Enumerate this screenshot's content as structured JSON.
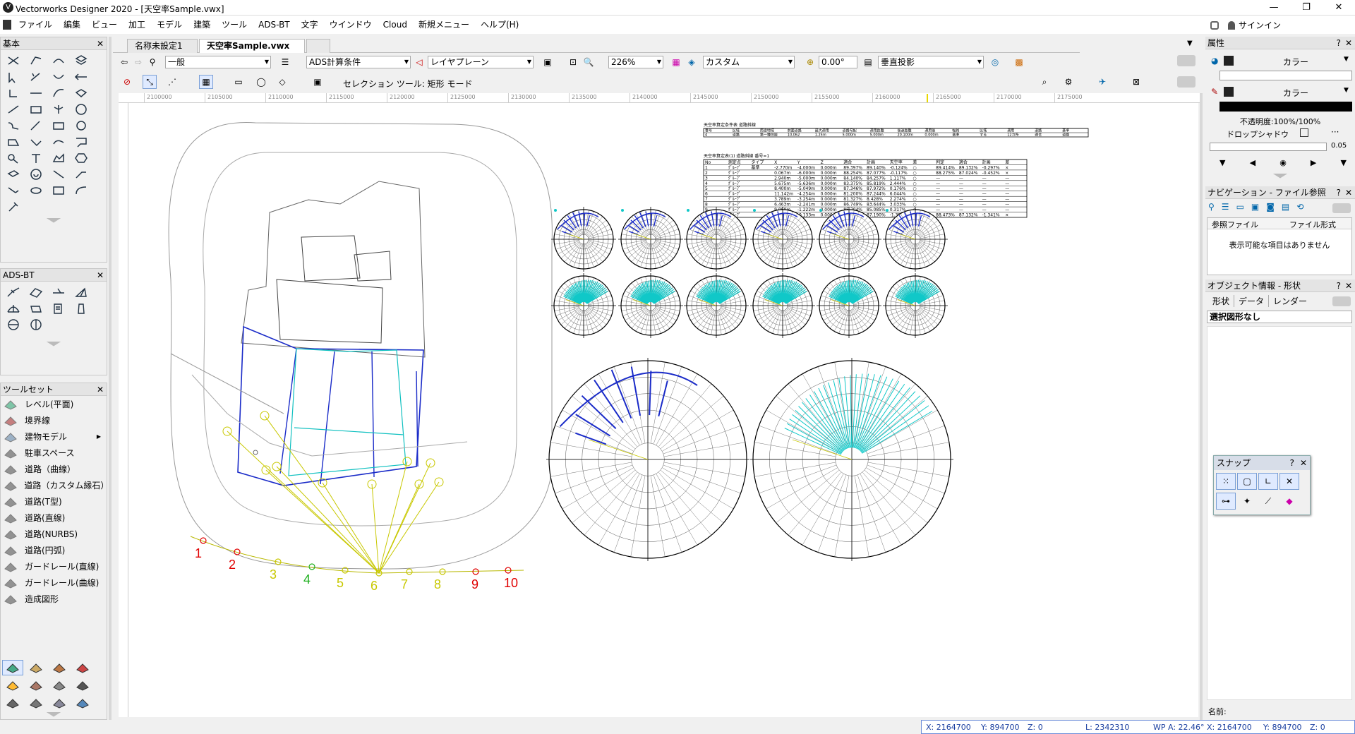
{
  "window": {
    "title": "Vectorworks Designer 2020 - [天空率Sample.vwx]",
    "min": "—",
    "max": "❐",
    "close": "✕"
  },
  "menu": [
    "ファイル",
    "編集",
    "ビュー",
    "加工",
    "モデル",
    "建築",
    "ツール",
    "ADS-BT",
    "文字",
    "ウインドウ",
    "Cloud",
    "新規メニュー",
    "ヘルプ(H)"
  ],
  "signin": "サインイン",
  "tabs": [
    "名称未設定1",
    "天空率Sample.vwx"
  ],
  "viewbar": {
    "class": "一般",
    "layer_dd": "ADS計算条件",
    "plane": "レイヤプレーン",
    "zoom": "226%",
    "view": "カスタム",
    "angle": "0.00°",
    "projection": "垂直投影"
  },
  "modebar": {
    "label": "セレクション ツール: 矩形 モード"
  },
  "palettes": {
    "basic": "基本",
    "adsbt": "ADS-BT",
    "toolset": "ツールセット"
  },
  "toolset": [
    "レベル(平面)",
    "境界線",
    "建物モデル",
    "駐車スペース",
    "道路（曲線）",
    "道路（カスタム縁石）",
    "道路(T型)",
    "道路(直線)",
    "道路(NURBS)",
    "道路(円弧)",
    "ガードレール(直線)",
    "ガードレール(曲線)",
    "造成図形"
  ],
  "ruler": [
    "2100000",
    "2105000",
    "2110000",
    "2115000",
    "2120000",
    "2125000",
    "2130000",
    "2135000",
    "2140000",
    "2145000",
    "2150000",
    "2155000",
    "2160000",
    "2165000",
    "2170000",
    "2175000"
  ],
  "points": [
    "1",
    "2",
    "3",
    "4",
    "5",
    "6",
    "7",
    "8",
    "9",
    "10"
  ],
  "point_colors": [
    "#e00000",
    "#e00000",
    "#c8c800",
    "#20b020",
    "#c8c800",
    "#c8c800",
    "#c8c800",
    "#c8c800",
    "#e00000",
    "#e00000"
  ],
  "table1": {
    "title": "天空率算定条件表 道路斜線",
    "headers": [
      "番号",
      "区域",
      "用途地域",
      "前面道路",
      "最大適用",
      "道路勾配",
      "適用距離",
      "後退距離",
      "適用後",
      "幅員",
      "区域",
      "適用",
      "道路",
      "基準"
    ],
    "row": [
      "4",
      "道路",
      "第一種住居",
      "10,062",
      "1.25m",
      "5.000m",
      "5.000m",
      "20.100m",
      "0.000m",
      "基準",
      "する",
      "12カ所",
      "適合",
      "道路"
    ]
  },
  "table2": {
    "title": "天空率算定表(1) 道路斜線 番号=1",
    "headers": [
      "No",
      "測定点",
      "タイプ",
      "X",
      "Y",
      "Z",
      "適合",
      "計画",
      "天空率",
      "差",
      "判定",
      "適合",
      "計画",
      "差",
      "判定"
    ],
    "rows": [
      [
        "1",
        "ｸﾞﾙｰﾌﾟ",
        "基準",
        "-2.770m",
        "-4.000m",
        "0.000m",
        "89.397%",
        "89.140%",
        "-0.124%",
        "○",
        "89.414%",
        "89.132%",
        "-0.297%",
        "×"
      ],
      [
        "2",
        "ｸﾞﾙｰﾌﾟ",
        "",
        "0.067m",
        "-6.000m",
        "0.000m",
        "88.254%",
        "87.077%",
        "-0.117%",
        "○",
        "88.275%",
        "87.024%",
        "-0.452%",
        "×"
      ],
      [
        "3",
        "ｸﾞﾙｰﾌﾟ",
        "",
        "2.940m",
        "-5.000m",
        "0.000m",
        "84.140%",
        "84.257%",
        "1.117%",
        "○",
        "—",
        "—",
        "—",
        "—"
      ],
      [
        "4",
        "ｸﾞﾙｰﾌﾟ",
        "",
        "5.675m",
        "-5.636m",
        "0.000m",
        "83.375%",
        "85.819%",
        "2.444%",
        "○",
        "—",
        "—",
        "—",
        "—"
      ],
      [
        "5",
        "ｸﾞﾙｰﾌﾟ",
        "",
        "8.400m",
        "-5.049m",
        "0.000m",
        "87.346%",
        "87.972%",
        "0.176%",
        "○",
        "—",
        "—",
        "—",
        "—"
      ],
      [
        "6",
        "ｸﾞﾙｰﾌﾟ",
        "",
        "11.142m",
        "-4.254m",
        "0.000m",
        "81.200%",
        "87.244%",
        "6.044%",
        "○",
        "—",
        "—",
        "—",
        "—"
      ],
      [
        "7",
        "ｸﾞﾙｰﾌﾟ",
        "",
        "3.789m",
        "-3.254m",
        "0.000m",
        "81.327%",
        "8.428%",
        "2.274%",
        "○",
        "—",
        "—",
        "—",
        "—"
      ],
      [
        "8",
        "ｸﾞﾙｰﾌﾟ",
        "",
        "6.463m",
        "-2.241m",
        "0.000m",
        "86.749%",
        "83.644%",
        "3.033%",
        "○",
        "—",
        "—",
        "—",
        "—"
      ],
      [
        "9",
        "ｸﾞﾙｰﾌﾟ",
        "",
        "9.060m",
        "-1.222m",
        "0.000m",
        "85.704%",
        "85.085%",
        "0.317%",
        "○",
        "—",
        "—",
        "—",
        "—"
      ],
      [
        "10",
        "ｸﾞﾙｰﾌﾟ",
        "",
        "21.692m",
        "-0.133m",
        "0.000m",
        "88.449%",
        "87.190%",
        "-1.387%",
        "×",
        "88.473%",
        "87.132%",
        "-1.341%",
        "×"
      ]
    ]
  },
  "rightpanel": {
    "attributes": "属性",
    "color": "カラー",
    "opacity": "不透明度:100%/100%",
    "shadow": "ドロップシャドウ",
    "lw": "0.05",
    "nav": "ナビゲーション - ファイル参照",
    "ref_file": "参照ファイル",
    "file_format": "ファイル形式",
    "no_items": "表示可能な項目はありません",
    "objinfo": "オブジェクト情報 - 形状",
    "tabs": [
      "形状",
      "データ",
      "レンダー"
    ],
    "nosel": "選択図形なし",
    "name_label": "名前:"
  },
  "snap": {
    "title": "スナップ"
  },
  "status": {
    "x": "X:   2164700",
    "y": "Y:   894700",
    "z": "Z:   0",
    "l": "L:  2342310",
    "wp": "WP A:    22.46°",
    "x2": "X:  2164700",
    "y2": "Y:  894700",
    "z2": "Z:  0"
  }
}
